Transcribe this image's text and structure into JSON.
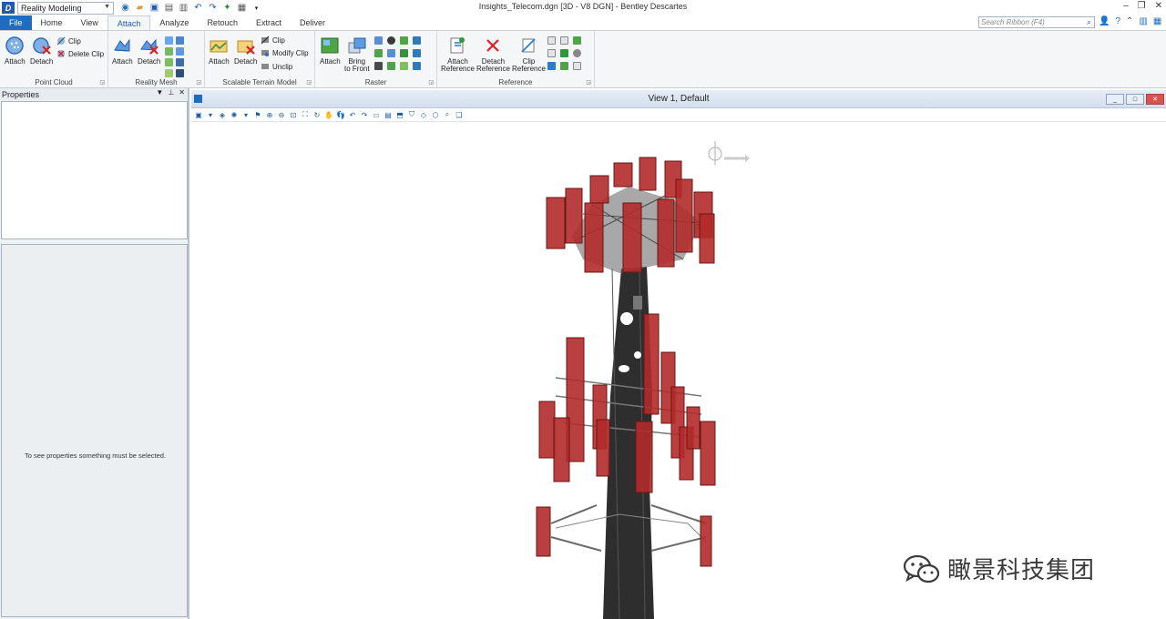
{
  "titlebar": {
    "workflow": "Reality Modeling",
    "window_title": "Insights_Telecom.dgn [3D - V8 DGN] - Bentley Descartes"
  },
  "tabs": [
    "File",
    "Home",
    "View",
    "Attach",
    "Analyze",
    "Retouch",
    "Extract",
    "Deliver"
  ],
  "active_tab": "Attach",
  "search": {
    "placeholder": "Search Ribbon (F4)"
  },
  "ribbon": {
    "point_cloud": {
      "label": "Point Cloud",
      "attach": "Attach",
      "detach": "Detach",
      "clip": "Clip",
      "delete_clip": "Delete Clip"
    },
    "reality_mesh": {
      "label": "Reality Mesh",
      "attach": "Attach",
      "detach": "Detach"
    },
    "terrain": {
      "label": "Scalable Terrain Model",
      "attach": "Attach",
      "detach": "Detach",
      "clip": "Clip",
      "modify_clip": "Modify Clip",
      "unclip": "Unclip"
    },
    "raster": {
      "label": "Raster",
      "attach": "Attach",
      "bring_front_1": "Bring",
      "bring_front_2": "to Front"
    },
    "reference": {
      "label": "Reference",
      "attach_1": "Attach",
      "attach_2": "Reference",
      "detach_1": "Detach",
      "detach_2": "Reference",
      "clip_1": "Clip",
      "clip_2": "Reference"
    }
  },
  "properties": {
    "title": "Properties",
    "empty_message": "To see properties something must be selected."
  },
  "view": {
    "title": "View 1, Default"
  },
  "watermark": {
    "text": "瞰景科技集团"
  },
  "colors": {
    "accent": "#1f6cc0",
    "antenna": "#b32a2a",
    "tower": "#2e2e2e"
  }
}
